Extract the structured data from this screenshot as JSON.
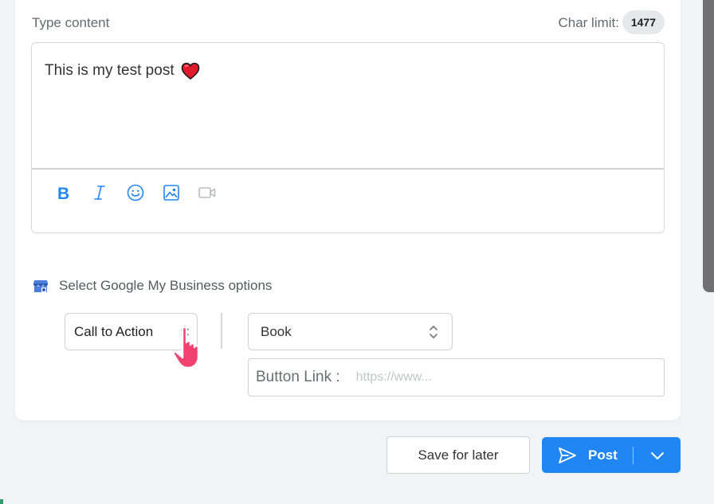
{
  "composer": {
    "type_label": "Type content",
    "char_limit_label": "Char limit:",
    "char_limit_value": "1477",
    "content_text": "This is my test post"
  },
  "toolbar": {
    "icons": [
      "bold-icon",
      "italic-icon",
      "emoji-icon",
      "image-icon",
      "video-icon"
    ]
  },
  "gmb": {
    "label": "Select Google My Business options",
    "action_type": "Call to Action",
    "action_value": "Book",
    "button_link_label": "Button Link :",
    "button_link_placeholder": "https://www...",
    "button_link_value": ""
  },
  "actions": {
    "save_label": "Save for later",
    "post_label": "Post"
  },
  "colors": {
    "accent": "#1f86f2",
    "icon_blue": "#1f86f2",
    "heart": "#e0192b",
    "pointer_hand": "#f0416f"
  }
}
